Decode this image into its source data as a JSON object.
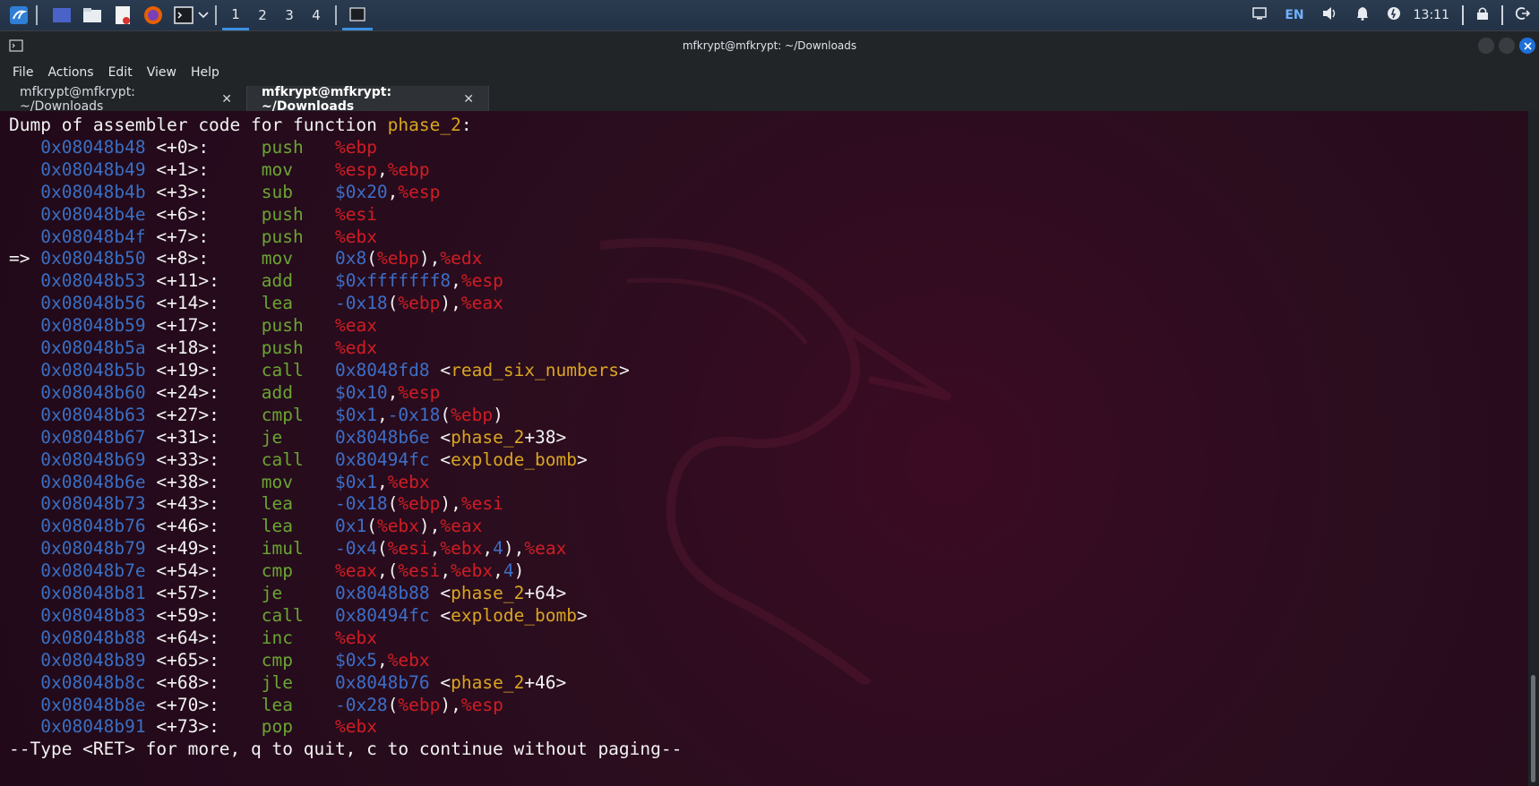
{
  "taskbar": {
    "workspaces": [
      "1",
      "2",
      "3",
      "4"
    ],
    "active_workspace": "1",
    "language": "EN",
    "clock": "13:11",
    "icons": [
      "kali-menu-icon",
      "desktop-icon",
      "file-manager-icon",
      "text-editor-icon",
      "firefox-icon",
      "terminal-icon",
      "chevron-down-icon"
    ],
    "tray_icons": [
      "display-icon",
      "volume-icon",
      "bell-icon",
      "power-icon",
      "lock-icon",
      "logout-icon"
    ]
  },
  "window": {
    "title": "mfkrypt@mfkrypt: ~/Downloads",
    "menu": [
      "File",
      "Actions",
      "Edit",
      "View",
      "Help"
    ],
    "tabs": [
      {
        "label": "mfkrypt@mfkrypt: ~/Downloads",
        "active": false
      },
      {
        "label": "mfkrypt@mfkrypt: ~/Downloads",
        "active": true
      }
    ],
    "tab_close": "✕"
  },
  "terminal": {
    "header_prefix": "Dump of assembler code for function ",
    "header_function": "phase_2",
    "header_suffix": ":",
    "current_marker": "=>",
    "lines": [
      {
        "addr": "0x08048b48",
        "off": "<+0>:",
        "op": "push",
        "args": [
          [
            "reg",
            "%ebp"
          ]
        ]
      },
      {
        "addr": "0x08048b49",
        "off": "<+1>:",
        "op": "mov",
        "args": [
          [
            "reg",
            "%esp"
          ],
          [
            "punc",
            ","
          ],
          [
            "reg",
            "%ebp"
          ]
        ]
      },
      {
        "addr": "0x08048b4b",
        "off": "<+3>:",
        "op": "sub",
        "args": [
          [
            "imm",
            "$0x20"
          ],
          [
            "punc",
            ","
          ],
          [
            "reg",
            "%esp"
          ]
        ]
      },
      {
        "addr": "0x08048b4e",
        "off": "<+6>:",
        "op": "push",
        "args": [
          [
            "reg",
            "%esi"
          ]
        ]
      },
      {
        "addr": "0x08048b4f",
        "off": "<+7>:",
        "op": "push",
        "args": [
          [
            "reg",
            "%ebx"
          ]
        ]
      },
      {
        "addr": "0x08048b50",
        "off": "<+8>:",
        "op": "mov",
        "current": true,
        "args": [
          [
            "imm",
            "0x8"
          ],
          [
            "punc",
            "("
          ],
          [
            "reg",
            "%ebp"
          ],
          [
            "punc",
            "),"
          ],
          [
            "reg",
            "%edx"
          ]
        ]
      },
      {
        "addr": "0x08048b53",
        "off": "<+11>:",
        "op": "add",
        "args": [
          [
            "imm",
            "$0xfffffff8"
          ],
          [
            "punc",
            ","
          ],
          [
            "reg",
            "%esp"
          ]
        ]
      },
      {
        "addr": "0x08048b56",
        "off": "<+14>:",
        "op": "lea",
        "args": [
          [
            "imm",
            "-0x18"
          ],
          [
            "punc",
            "("
          ],
          [
            "reg",
            "%ebp"
          ],
          [
            "punc",
            "),"
          ],
          [
            "reg",
            "%eax"
          ]
        ]
      },
      {
        "addr": "0x08048b59",
        "off": "<+17>:",
        "op": "push",
        "args": [
          [
            "reg",
            "%eax"
          ]
        ]
      },
      {
        "addr": "0x08048b5a",
        "off": "<+18>:",
        "op": "push",
        "args": [
          [
            "reg",
            "%edx"
          ]
        ]
      },
      {
        "addr": "0x08048b5b",
        "off": "<+19>:",
        "op": "call",
        "args": [
          [
            "imm",
            "0x8048fd8"
          ],
          [
            "punc",
            " <"
          ],
          [
            "sym",
            "read_six_numbers"
          ],
          [
            "punc",
            ">"
          ]
        ]
      },
      {
        "addr": "0x08048b60",
        "off": "<+24>:",
        "op": "add",
        "args": [
          [
            "imm",
            "$0x10"
          ],
          [
            "punc",
            ","
          ],
          [
            "reg",
            "%esp"
          ]
        ]
      },
      {
        "addr": "0x08048b63",
        "off": "<+27>:",
        "op": "cmpl",
        "args": [
          [
            "imm",
            "$0x1"
          ],
          [
            "punc",
            ","
          ],
          [
            "imm",
            "-0x18"
          ],
          [
            "punc",
            "("
          ],
          [
            "reg",
            "%ebp"
          ],
          [
            "punc",
            ")"
          ]
        ]
      },
      {
        "addr": "0x08048b67",
        "off": "<+31>:",
        "op": "je",
        "args": [
          [
            "imm",
            "0x8048b6e"
          ],
          [
            "punc",
            " <"
          ],
          [
            "sym",
            "phase_2"
          ],
          [
            "punc",
            "+38>"
          ]
        ]
      },
      {
        "addr": "0x08048b69",
        "off": "<+33>:",
        "op": "call",
        "args": [
          [
            "imm",
            "0x80494fc"
          ],
          [
            "punc",
            " <"
          ],
          [
            "sym",
            "explode_bomb"
          ],
          [
            "punc",
            ">"
          ]
        ]
      },
      {
        "addr": "0x08048b6e",
        "off": "<+38>:",
        "op": "mov",
        "args": [
          [
            "imm",
            "$0x1"
          ],
          [
            "punc",
            ","
          ],
          [
            "reg",
            "%ebx"
          ]
        ]
      },
      {
        "addr": "0x08048b73",
        "off": "<+43>:",
        "op": "lea",
        "args": [
          [
            "imm",
            "-0x18"
          ],
          [
            "punc",
            "("
          ],
          [
            "reg",
            "%ebp"
          ],
          [
            "punc",
            "),"
          ],
          [
            "reg",
            "%esi"
          ]
        ]
      },
      {
        "addr": "0x08048b76",
        "off": "<+46>:",
        "op": "lea",
        "args": [
          [
            "imm",
            "0x1"
          ],
          [
            "punc",
            "("
          ],
          [
            "reg",
            "%ebx"
          ],
          [
            "punc",
            "),"
          ],
          [
            "reg",
            "%eax"
          ]
        ]
      },
      {
        "addr": "0x08048b79",
        "off": "<+49>:",
        "op": "imul",
        "args": [
          [
            "imm",
            "-0x4"
          ],
          [
            "punc",
            "("
          ],
          [
            "reg",
            "%esi"
          ],
          [
            "punc",
            ","
          ],
          [
            "reg",
            "%ebx"
          ],
          [
            "punc",
            ","
          ],
          [
            "imm",
            "4"
          ],
          [
            "punc",
            "),"
          ],
          [
            "reg",
            "%eax"
          ]
        ]
      },
      {
        "addr": "0x08048b7e",
        "off": "<+54>:",
        "op": "cmp",
        "args": [
          [
            "reg",
            "%eax"
          ],
          [
            "punc",
            ",("
          ],
          [
            "reg",
            "%esi"
          ],
          [
            "punc",
            ","
          ],
          [
            "reg",
            "%ebx"
          ],
          [
            "punc",
            ","
          ],
          [
            "imm",
            "4"
          ],
          [
            "punc",
            ")"
          ]
        ]
      },
      {
        "addr": "0x08048b81",
        "off": "<+57>:",
        "op": "je",
        "args": [
          [
            "imm",
            "0x8048b88"
          ],
          [
            "punc",
            " <"
          ],
          [
            "sym",
            "phase_2"
          ],
          [
            "punc",
            "+64>"
          ]
        ]
      },
      {
        "addr": "0x08048b83",
        "off": "<+59>:",
        "op": "call",
        "args": [
          [
            "imm",
            "0x80494fc"
          ],
          [
            "punc",
            " <"
          ],
          [
            "sym",
            "explode_bomb"
          ],
          [
            "punc",
            ">"
          ]
        ]
      },
      {
        "addr": "0x08048b88",
        "off": "<+64>:",
        "op": "inc",
        "args": [
          [
            "reg",
            "%ebx"
          ]
        ]
      },
      {
        "addr": "0x08048b89",
        "off": "<+65>:",
        "op": "cmp",
        "args": [
          [
            "imm",
            "$0x5"
          ],
          [
            "punc",
            ","
          ],
          [
            "reg",
            "%ebx"
          ]
        ]
      },
      {
        "addr": "0x08048b8c",
        "off": "<+68>:",
        "op": "jle",
        "args": [
          [
            "imm",
            "0x8048b76"
          ],
          [
            "punc",
            " <"
          ],
          [
            "sym",
            "phase_2"
          ],
          [
            "punc",
            "+46>"
          ]
        ]
      },
      {
        "addr": "0x08048b8e",
        "off": "<+70>:",
        "op": "lea",
        "args": [
          [
            "imm",
            "-0x28"
          ],
          [
            "punc",
            "("
          ],
          [
            "reg",
            "%ebp"
          ],
          [
            "punc",
            "),"
          ],
          [
            "reg",
            "%esp"
          ]
        ]
      },
      {
        "addr": "0x08048b91",
        "off": "<+73>:",
        "op": "pop",
        "args": [
          [
            "reg",
            "%ebx"
          ]
        ]
      }
    ],
    "pager_prompt": "--Type <RET> for more, q to quit, c to continue without paging--"
  }
}
